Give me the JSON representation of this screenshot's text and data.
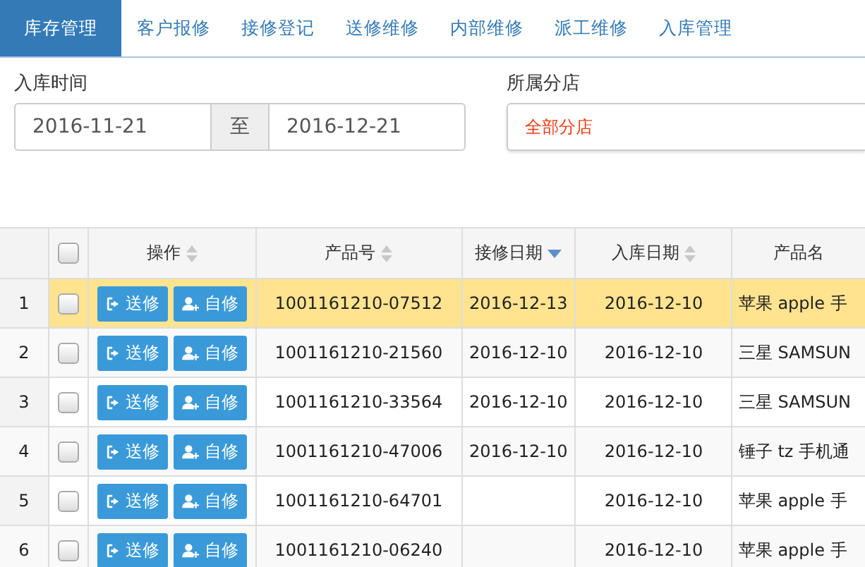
{
  "tabs": [
    {
      "label": "库存管理",
      "selected": true
    },
    {
      "label": "客户报修",
      "selected": false
    },
    {
      "label": "接修登记",
      "selected": false
    },
    {
      "label": "送修维修",
      "selected": false
    },
    {
      "label": "内部维修",
      "selected": false
    },
    {
      "label": "派工维修",
      "selected": false
    },
    {
      "label": "入库管理",
      "selected": false
    }
  ],
  "filters": {
    "date_label": "入库时间",
    "date_from": "2016-11-21",
    "separator": "至",
    "date_to": "2016-12-21",
    "store_label": "所属分店",
    "store_value": "全部分店"
  },
  "table": {
    "all_checked": false,
    "columns": [
      {
        "label": "操作",
        "sorted_desc": false
      },
      {
        "label": "产品号",
        "sorted_desc": false
      },
      {
        "label": "接修日期",
        "sorted_desc": true
      },
      {
        "label": "入库日期",
        "sorted_desc": false
      },
      {
        "label": "产品名"
      }
    ],
    "rows": [
      {
        "index": "1",
        "checked": false,
        "selected": true,
        "send_label": "送修",
        "self_label": "自修",
        "product_no": "1001161210-07512",
        "repair_date": "2016-12-13",
        "stock_date": "2016-12-10",
        "product_name": "苹果 apple 手"
      },
      {
        "index": "2",
        "checked": false,
        "selected": false,
        "send_label": "送修",
        "self_label": "自修",
        "product_no": "1001161210-21560",
        "repair_date": "2016-12-10",
        "stock_date": "2016-12-10",
        "product_name": "三星 SAMSUN"
      },
      {
        "index": "3",
        "checked": false,
        "selected": false,
        "send_label": "送修",
        "self_label": "自修",
        "product_no": "1001161210-33564",
        "repair_date": "2016-12-10",
        "stock_date": "2016-12-10",
        "product_name": "三星 SAMSUN"
      },
      {
        "index": "4",
        "checked": false,
        "selected": false,
        "send_label": "送修",
        "self_label": "自修",
        "product_no": "1001161210-47006",
        "repair_date": "2016-12-10",
        "stock_date": "2016-12-10",
        "product_name": "锤子 tz 手机通"
      },
      {
        "index": "5",
        "checked": false,
        "selected": false,
        "send_label": "送修",
        "self_label": "自修",
        "product_no": "1001161210-64701",
        "stock_date": "2016-12-10",
        "product_name": "苹果 apple 手"
      },
      {
        "index": "6",
        "checked": false,
        "selected": false,
        "send_label": "送修",
        "self_label": "自修",
        "product_no": "1001161210-06240",
        "stock_date": "2016-12-10",
        "product_name": "苹果 apple 手"
      }
    ]
  }
}
